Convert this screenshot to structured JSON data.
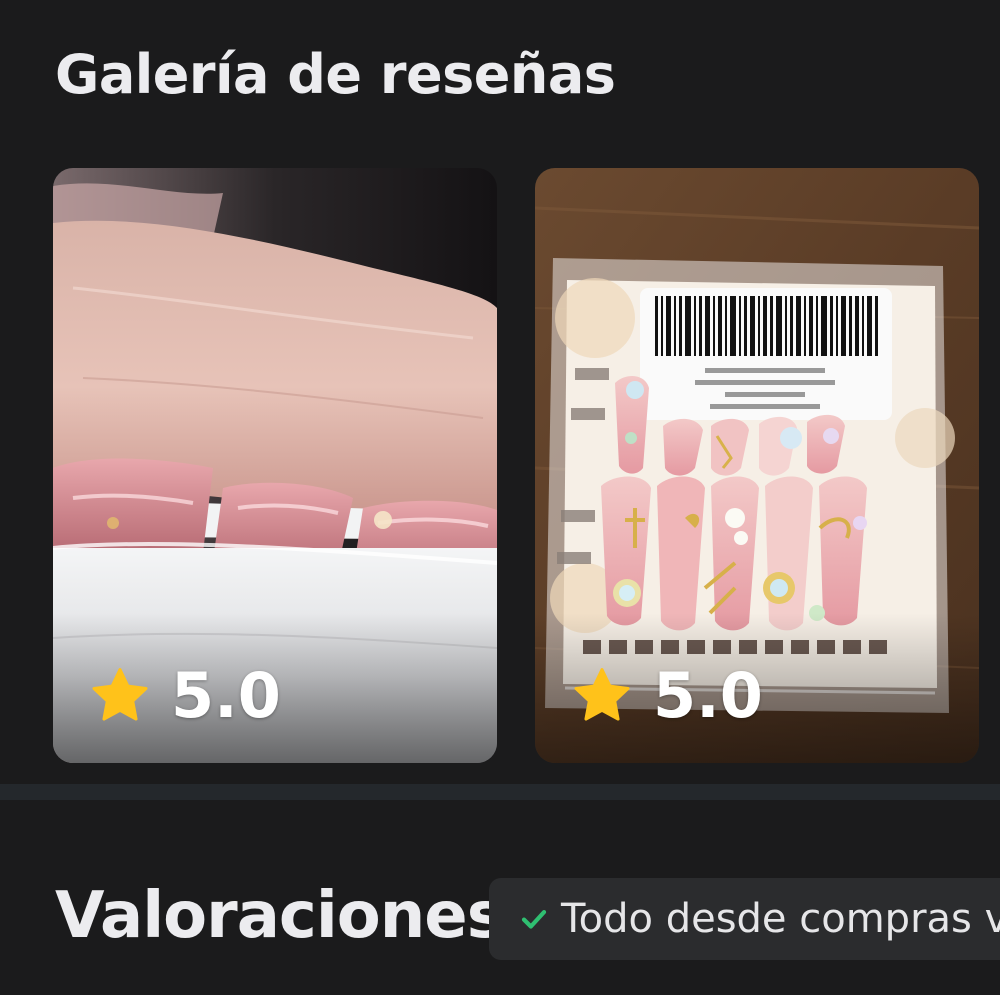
{
  "gallery": {
    "title": "Galería de reseñas",
    "reviews": [
      {
        "rating": "5.0",
        "photo": "close-up of pink press-on nails on a finger"
      },
      {
        "rating": "5.0",
        "photo": "packaged set of pink stiletto press-on nails"
      }
    ]
  },
  "ratings": {
    "title": "Valoraciones",
    "filter_label": "Todo desde compras v"
  },
  "colors": {
    "background": "#1b1b1c",
    "star": "#ffc21a",
    "check": "#2fbf71",
    "chip": "#2b2c2e"
  }
}
